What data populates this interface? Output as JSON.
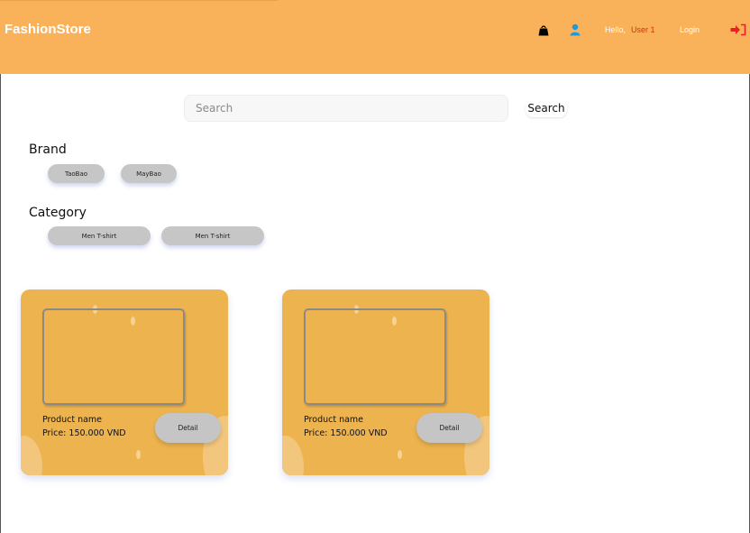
{
  "header": {
    "logo": "FashionStore",
    "bag_icon": "shopping-bag-icon",
    "user_icon": "user-icon",
    "hello_label": "Hello,",
    "username": "User 1",
    "login_label": "Login",
    "logout_icon": "logout-icon",
    "colors": {
      "background": "#fab25a",
      "username": "#e8231f",
      "user_icon": "#1d9bd8",
      "logout_icon": "#e8231f"
    }
  },
  "search": {
    "placeholder": "Search",
    "value": "",
    "button_label": "Search"
  },
  "filters": {
    "brand": {
      "title": "Brand",
      "options": [
        "TaoBao",
        "MayBao"
      ]
    },
    "category": {
      "title": "Category",
      "options": [
        "Men T-shirt",
        "Men T-shirt"
      ]
    }
  },
  "products": [
    {
      "name": "Product name",
      "price": "Price: 150.000 VND",
      "button_label": "Detail"
    },
    {
      "name": "Product name",
      "price": "Price: 150.000 VND",
      "button_label": "Detail"
    }
  ],
  "colors": {
    "card": "#ecb34f",
    "chip": "#c6c6c6"
  }
}
